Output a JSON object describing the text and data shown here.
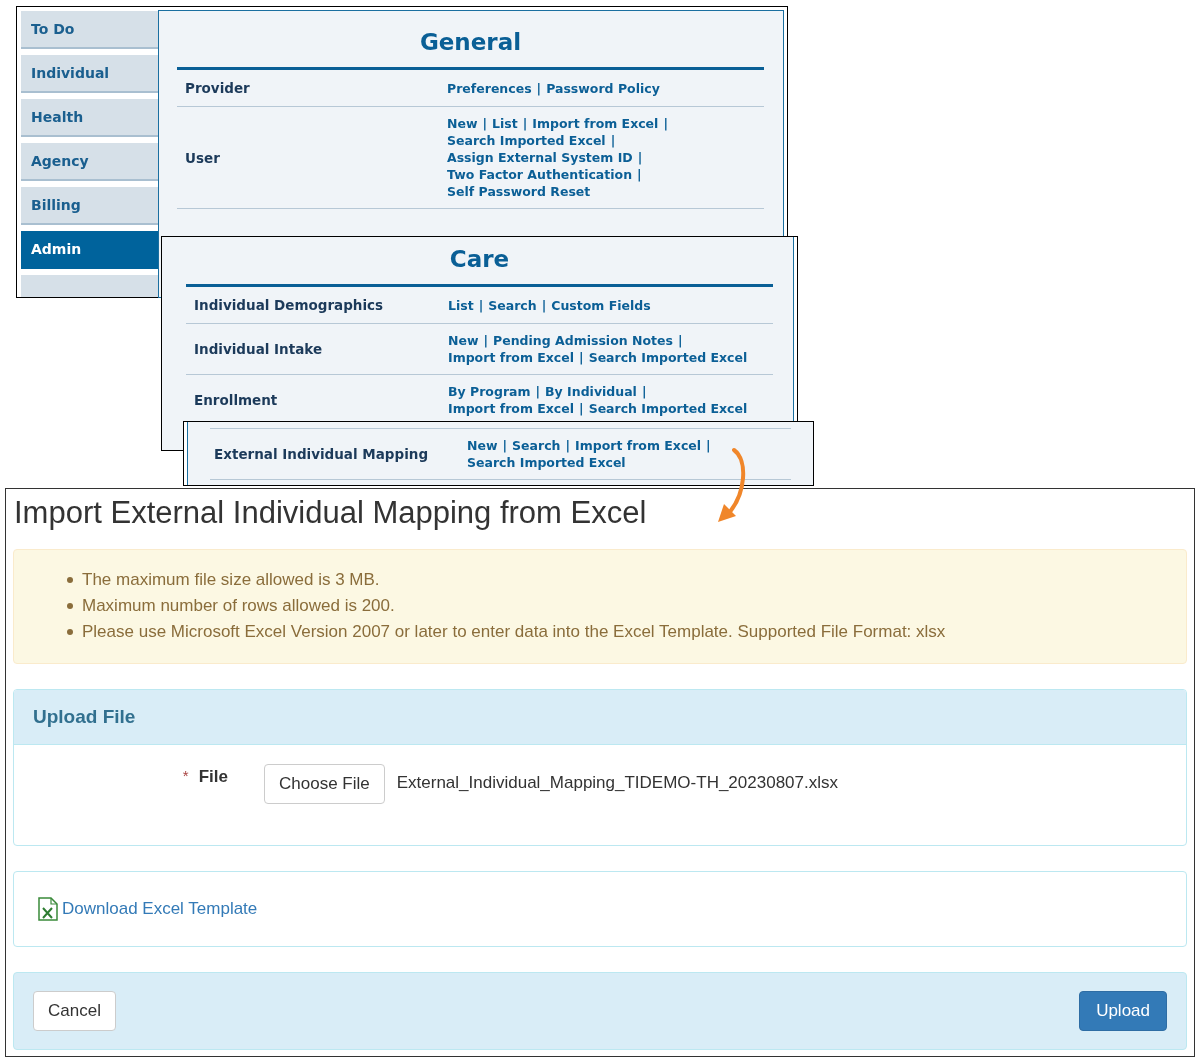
{
  "separator": "|",
  "sidebar": {
    "items": [
      {
        "label": "To Do",
        "selected": false
      },
      {
        "label": "Individual",
        "selected": false
      },
      {
        "label": "Health",
        "selected": false
      },
      {
        "label": "Agency",
        "selected": false
      },
      {
        "label": "Billing",
        "selected": false
      },
      {
        "label": "Admin",
        "selected": true
      }
    ]
  },
  "general": {
    "title": "General",
    "rows": [
      {
        "label": "Provider",
        "lines": [
          [
            "Preferences",
            "Password Policy"
          ]
        ]
      },
      {
        "label": "User",
        "lines": [
          [
            "New",
            "List",
            "Import from Excel"
          ],
          [
            "Search Imported Excel"
          ],
          [
            "Assign External System ID"
          ],
          [
            "Two Factor Authentication"
          ],
          [
            "Self Password Reset"
          ]
        ]
      }
    ]
  },
  "care": {
    "title": "Care",
    "rows": [
      {
        "label": "Individual Demographics",
        "lines": [
          [
            "List",
            "Search",
            "Custom Fields"
          ]
        ]
      },
      {
        "label": "Individual Intake",
        "lines": [
          [
            "New",
            "Pending Admission Notes"
          ],
          [
            "Import from Excel",
            "Search Imported Excel"
          ]
        ]
      },
      {
        "label": "Enrollment",
        "lines": [
          [
            "By Program",
            "By Individual"
          ],
          [
            "Import from Excel",
            "Search Imported Excel"
          ]
        ]
      }
    ]
  },
  "mapping": {
    "label": "External Individual Mapping",
    "lines": [
      [
        "New",
        "Search",
        "Import from Excel"
      ],
      [
        "Search Imported Excel"
      ]
    ]
  },
  "form": {
    "title": "Import External Individual Mapping from Excel",
    "notices": [
      "The maximum file size allowed is 3 MB.",
      "Maximum number of rows allowed is 200.",
      "Please use Microsoft Excel Version 2007 or later to enter data into the Excel Template. Supported File Format: xlsx"
    ],
    "upload_panel": {
      "title": "Upload File",
      "required_mark": "*",
      "field_label": "File",
      "choose_button": "Choose File",
      "file_name": "External_Individual_Mapping_TIDEMO-TH_20230807.xlsx"
    },
    "download_link": "Download Excel Template",
    "buttons": {
      "cancel": "Cancel",
      "upload": "Upload"
    }
  }
}
